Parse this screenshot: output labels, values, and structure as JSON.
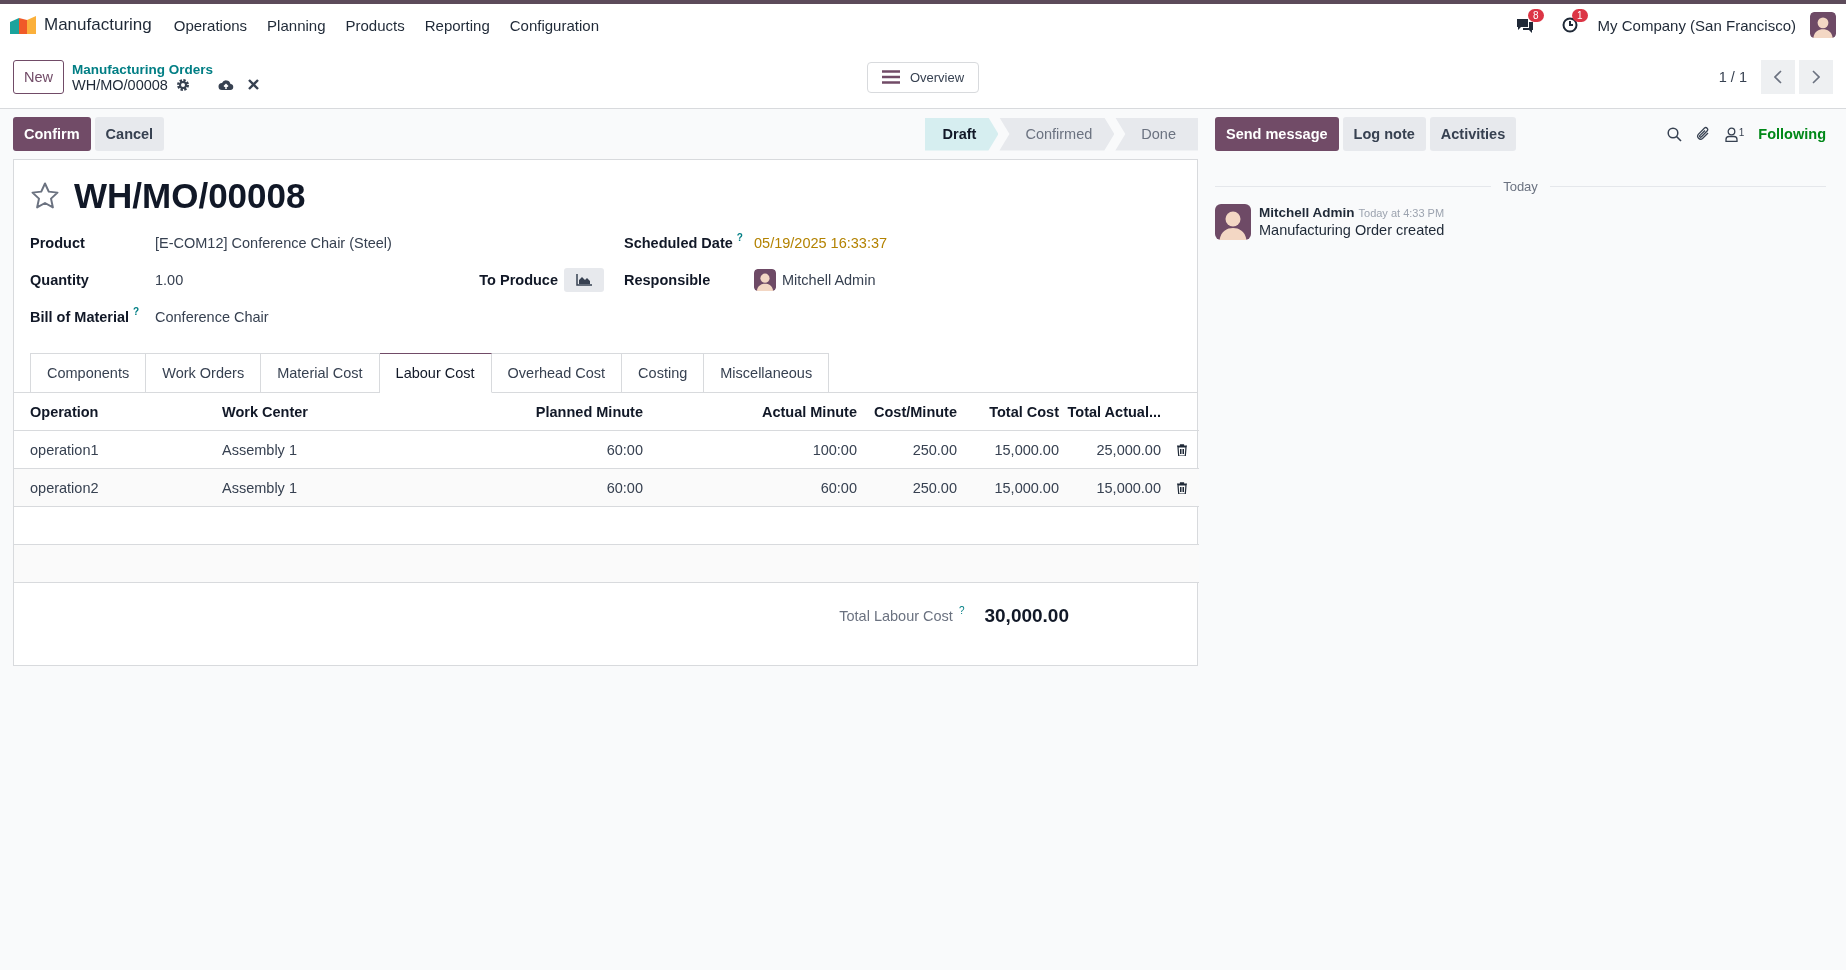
{
  "navbar": {
    "app_name": "Manufacturing",
    "menus": [
      "Operations",
      "Planning",
      "Products",
      "Reporting",
      "Configuration"
    ],
    "messages_badge": "8",
    "activities_badge": "1",
    "company": "My Company (San Francisco)"
  },
  "control_panel": {
    "new_button": "New",
    "breadcrumb": "Manufacturing Orders",
    "record": "WH/MO/00008",
    "overview_button": "Overview",
    "pager": "1 / 1"
  },
  "actions": [
    {
      "label": "Confirm",
      "kind": "primary"
    },
    {
      "label": "Cancel",
      "kind": "secondary"
    }
  ],
  "statusbar": [
    {
      "label": "Draft",
      "selected": true
    },
    {
      "label": "Confirmed",
      "selected": false
    },
    {
      "label": "Done",
      "selected": false
    }
  ],
  "form": {
    "title": "WH/MO/00008",
    "starred": false,
    "left_fields": [
      {
        "label": "Product",
        "value": "[E-COM12] Conference Chair (Steel)"
      },
      {
        "label": "Quantity",
        "value": "1.00",
        "extra_label": "To Produce"
      },
      {
        "label": "Bill of Material",
        "help": "?",
        "value": "Conference Chair"
      }
    ],
    "right_fields": [
      {
        "label": "Scheduled Date",
        "help": "?",
        "value": "05/19/2025 16:33:37",
        "kind": "date"
      },
      {
        "label": "Responsible",
        "value": "Mitchell Admin",
        "kind": "user"
      }
    ],
    "tabs": [
      {
        "label": "Components",
        "selected": false
      },
      {
        "label": "Work Orders",
        "selected": false
      },
      {
        "label": "Material Cost",
        "selected": false
      },
      {
        "label": "Labour Cost",
        "selected": true
      },
      {
        "label": "Overhead Cost",
        "selected": false
      },
      {
        "label": "Costing",
        "selected": false
      },
      {
        "label": "Miscellaneous",
        "selected": false
      }
    ],
    "table": {
      "columns": [
        "Operation",
        "Work Center",
        "Planned Minute",
        "Actual Minute",
        "Cost/Minute",
        "Total Cost",
        "Total Actual..."
      ],
      "rows": [
        [
          "operation1",
          "Assembly 1",
          "60:00",
          "100:00",
          "250.00",
          "15,000.00",
          "25,000.00"
        ],
        [
          "operation2",
          "Assembly 1",
          "60:00",
          "60:00",
          "250.00",
          "15,000.00",
          "15,000.00"
        ]
      ]
    },
    "total": {
      "label": "Total Labour Cost",
      "help": "?",
      "value": "30,000.00"
    }
  },
  "chatter": {
    "buttons": [
      {
        "label": "Send message",
        "kind": "primary"
      },
      {
        "label": "Log note",
        "kind": "secondary"
      },
      {
        "label": "Activities",
        "kind": "secondary"
      }
    ],
    "followers_count": "1",
    "following": "Following",
    "date_separator": "Today",
    "messages": [
      {
        "author": "Mitchell Admin",
        "time": "Today at 4:33 PM",
        "body": "Manufacturing Order created"
      }
    ]
  }
}
